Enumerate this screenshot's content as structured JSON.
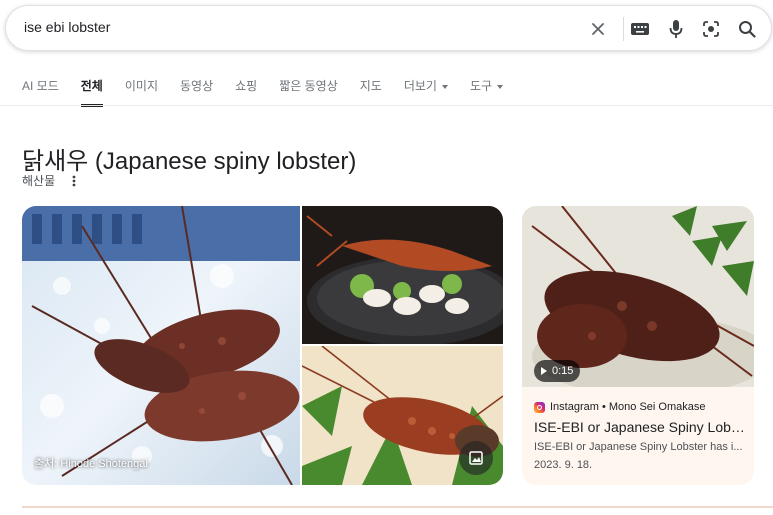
{
  "search": {
    "query": "ise ebi lobster"
  },
  "icons": {
    "clear": "close-icon",
    "keyboard": "keyboard-icon",
    "voice": "microphone-icon",
    "lens": "lens-camera-icon",
    "search": "search-icon"
  },
  "tabs": [
    {
      "label": "AI 모드"
    },
    {
      "label": "전체"
    },
    {
      "label": "이미지"
    },
    {
      "label": "동영상"
    },
    {
      "label": "쇼핑"
    },
    {
      "label": "짧은 동영상"
    },
    {
      "label": "지도"
    },
    {
      "label": "더보기"
    },
    {
      "label": "도구"
    }
  ],
  "knowledge": {
    "title": "닭새우 (Japanese spiny lobster)",
    "subtitle": "해산물"
  },
  "images": {
    "main_credit": "출처: Hinode Shotengai"
  },
  "video": {
    "duration": "0:15",
    "source": "Instagram • Mono Sei Omakase",
    "title": "ISE-EBI or Japanese Spiny Lobste...",
    "description": "ISE-EBI or Japanese Spiny Lobster has i...",
    "date": "2023. 9. 18."
  },
  "colors": {
    "accent_border": "#f2d7cc",
    "card_background": "#fff6ef"
  }
}
